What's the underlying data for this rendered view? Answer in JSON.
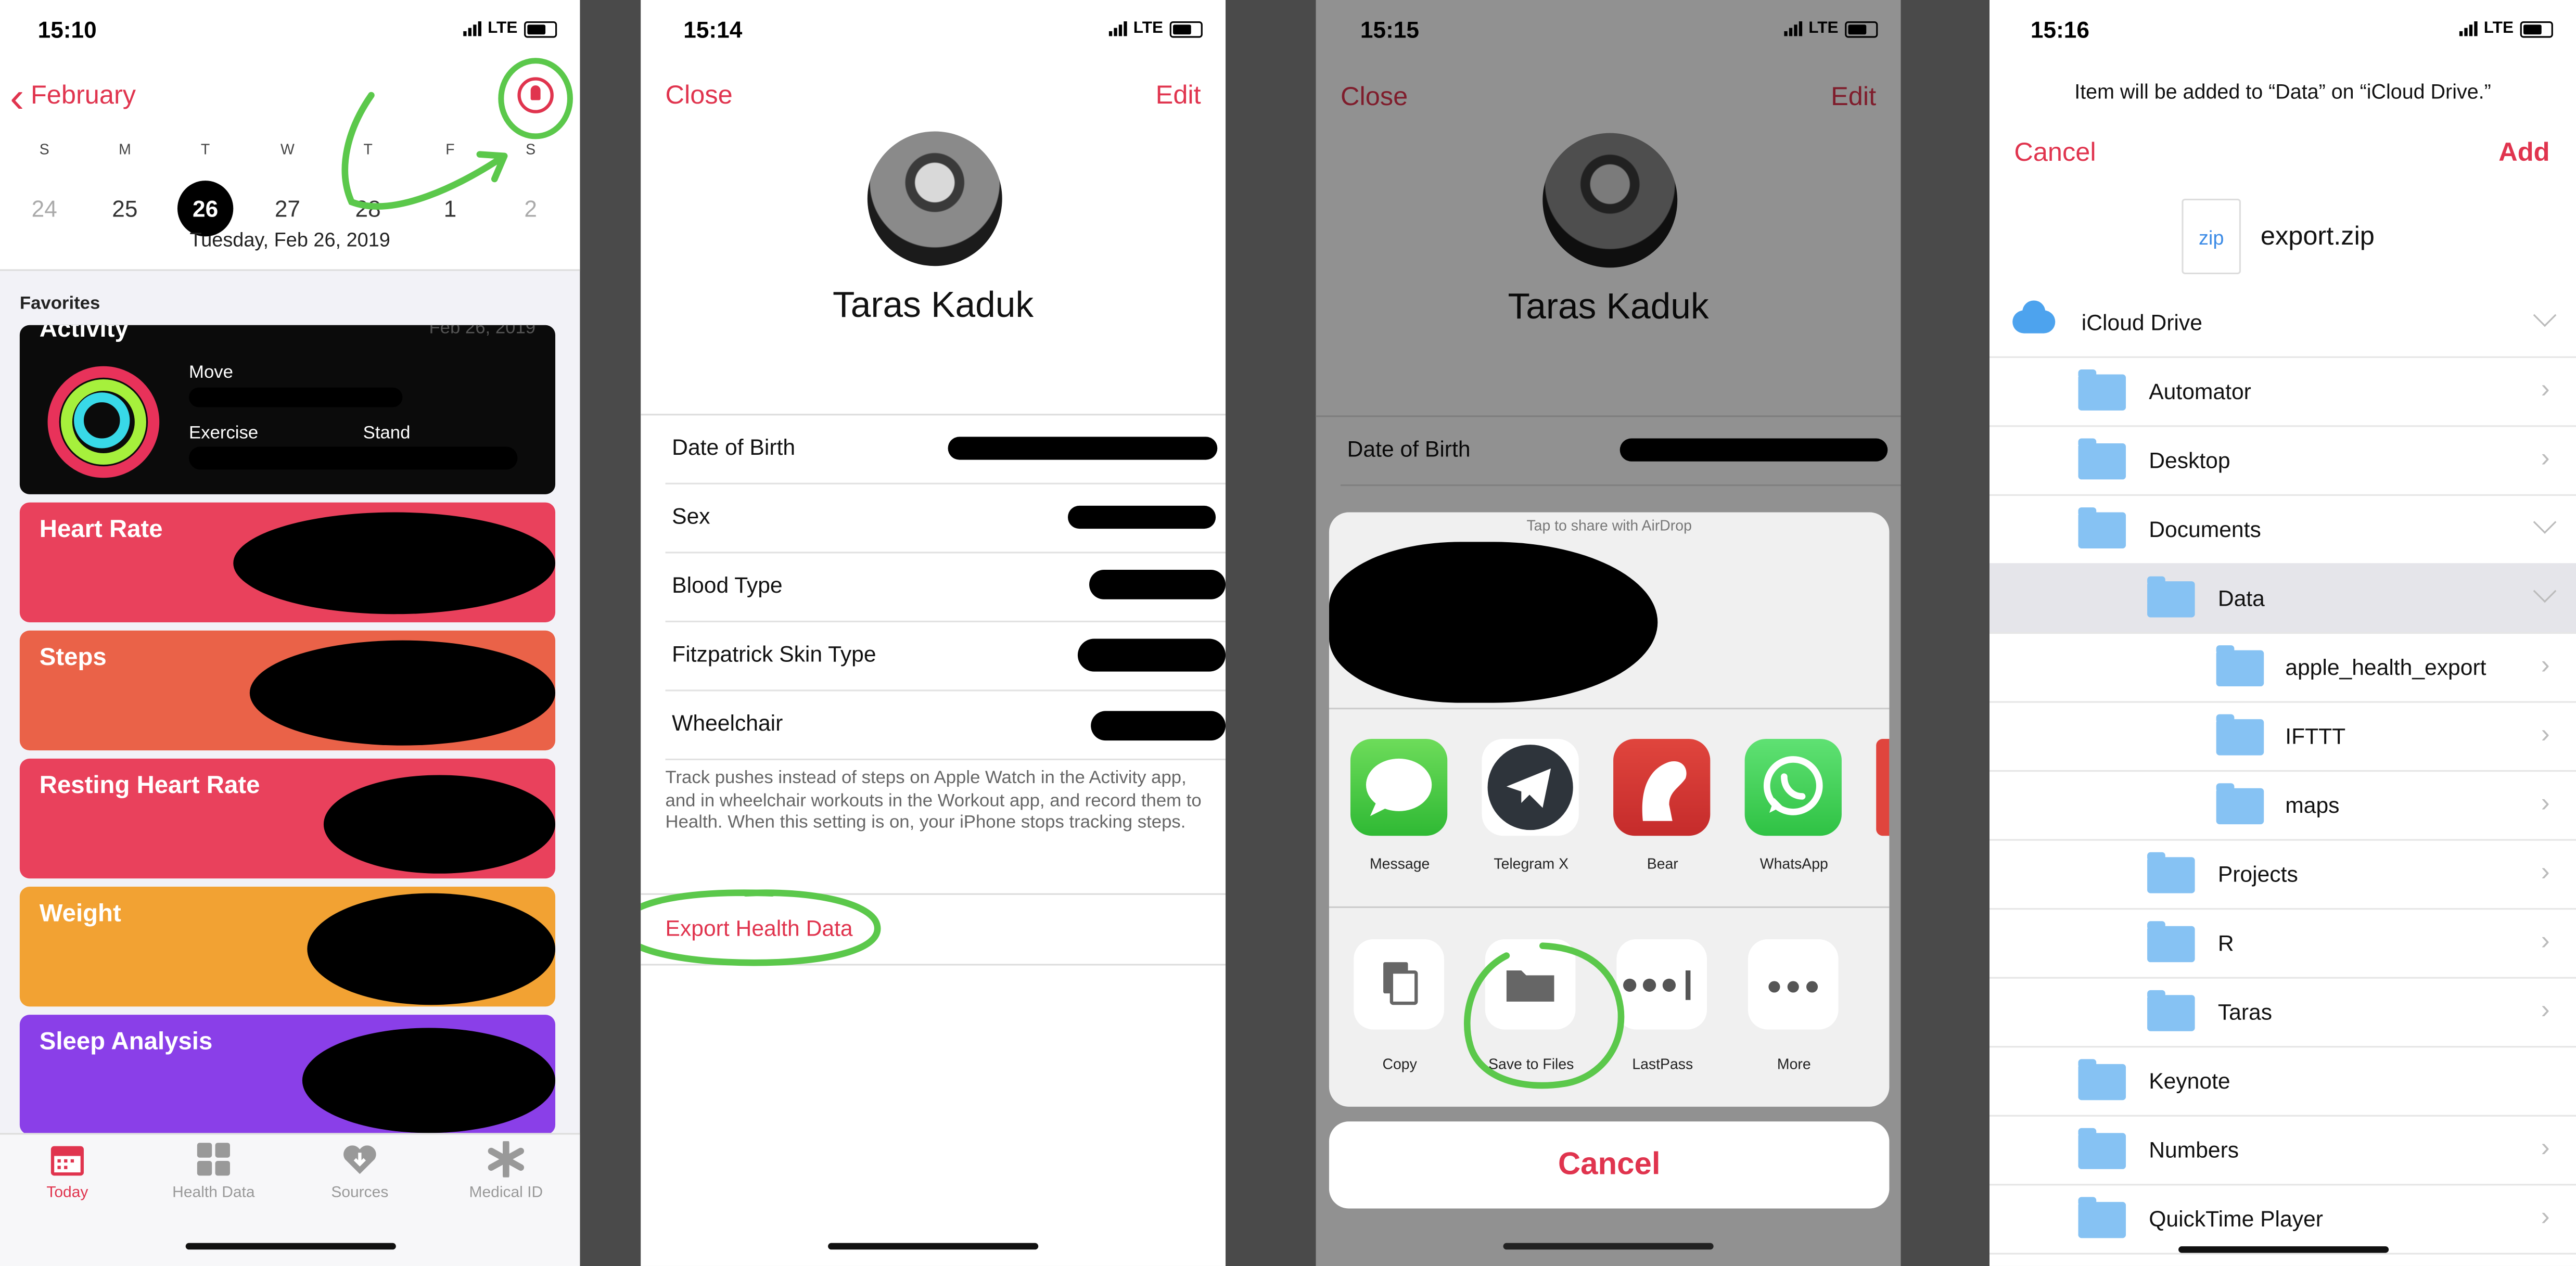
{
  "panel1": {
    "status_time": "15:10",
    "carrier": "LTE",
    "back_label": "February",
    "day_letters": [
      "S",
      "M",
      "T",
      "W",
      "T",
      "F",
      "S"
    ],
    "day_numbers": [
      "24",
      "25",
      "26",
      "27",
      "28",
      "1",
      "2"
    ],
    "date_label": "Tuesday, Feb 26, 2019",
    "favorites_label": "Favorites",
    "activity": {
      "title": "Activity",
      "date": "Feb 26, 2019",
      "move": "Move",
      "exercise": "Exercise",
      "stand": "Stand"
    },
    "cards": [
      {
        "title": "Heart Rate",
        "color": "#e9415c"
      },
      {
        "title": "Steps",
        "color": "#ea6248"
      },
      {
        "title": "Resting Heart Rate",
        "color": "#e9415c"
      },
      {
        "title": "Weight",
        "color": "#f2a233"
      },
      {
        "title": "Sleep Analysis",
        "color": "#8a3fe8"
      }
    ],
    "tabs": [
      "Today",
      "Health Data",
      "Sources",
      "Medical ID"
    ]
  },
  "panel2": {
    "status_time": "15:14",
    "carrier": "LTE",
    "close": "Close",
    "edit": "Edit",
    "name": "Taras Kaduk",
    "rows": [
      "Date of Birth",
      "Sex",
      "Blood Type",
      "Fitzpatrick Skin Type",
      "Wheelchair"
    ],
    "note": "Track pushes instead of steps on Apple Watch in the Activity app, and in wheelchair workouts in the Workout app, and record them to Health. When this setting is on, your iPhone stops tracking steps.",
    "export": "Export Health Data"
  },
  "panel3": {
    "status_time": "15:15",
    "carrier": "LTE",
    "close": "Close",
    "edit": "Edit",
    "name": "Taras Kaduk",
    "row": "Date of Birth",
    "airdrop": "Tap to share with AirDrop",
    "apps": [
      "Message",
      "Telegram X",
      "Bear",
      "WhatsApp"
    ],
    "actions": [
      "Copy",
      "Save to Files",
      "LastPass",
      "More"
    ],
    "cancel": "Cancel"
  },
  "panel4": {
    "status_time": "15:16",
    "carrier": "LTE",
    "info": "Item will be added to “Data” on “iCloud Drive.”",
    "cancel": "Cancel",
    "add": "Add",
    "file_type": "zip",
    "file_name": "export.zip",
    "folders": [
      {
        "name": "iCloud Drive"
      },
      {
        "name": "Automator"
      },
      {
        "name": "Desktop"
      },
      {
        "name": "Documents"
      },
      {
        "name": "Data"
      },
      {
        "name": "apple_health_export"
      },
      {
        "name": "IFTTT"
      },
      {
        "name": "maps"
      },
      {
        "name": "Projects"
      },
      {
        "name": "R"
      },
      {
        "name": "Taras"
      },
      {
        "name": "Keynote"
      },
      {
        "name": "Numbers"
      },
      {
        "name": "QuickTime Player"
      }
    ]
  },
  "colors": {
    "accent": "#e0344e",
    "annotation": "#5bc84b"
  }
}
